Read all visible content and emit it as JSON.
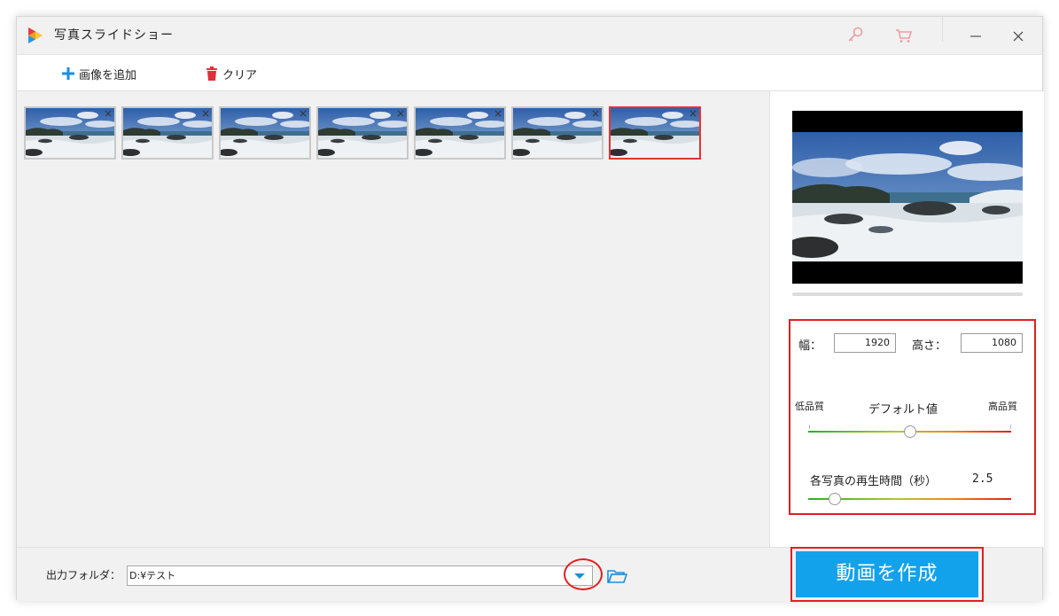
{
  "window": {
    "title": "写真スライドショー",
    "accent": "#12a2eb",
    "highlight": "#e02020"
  },
  "titlebar_icons": [
    "key-icon",
    "cart-icon",
    "minimize-icon",
    "close-icon"
  ],
  "toolbar": {
    "add_label": "画像を追加",
    "clear_label": "クリア"
  },
  "thumbnails": [
    {
      "selected": false,
      "close": "×"
    },
    {
      "selected": false,
      "close": "×"
    },
    {
      "selected": false,
      "close": "×"
    },
    {
      "selected": false,
      "close": "×"
    },
    {
      "selected": false,
      "close": "×"
    },
    {
      "selected": false,
      "close": "×"
    },
    {
      "selected": true,
      "close": "×"
    }
  ],
  "settings": {
    "width_label": "幅：",
    "width_value": "1920",
    "height_label": "高さ：",
    "height_value": "1080",
    "quality_low": "低品質",
    "quality_default": "デフォルト値",
    "quality_high": "高品質",
    "quality_level": 0.5,
    "duration_label": "各写真の再生時間（秒）",
    "duration_value": "2.5",
    "duration_level": 0.13
  },
  "bottom": {
    "output_label": "出力フォルダ：",
    "output_path": "D:¥テスト",
    "create_label": "動画を作成"
  }
}
